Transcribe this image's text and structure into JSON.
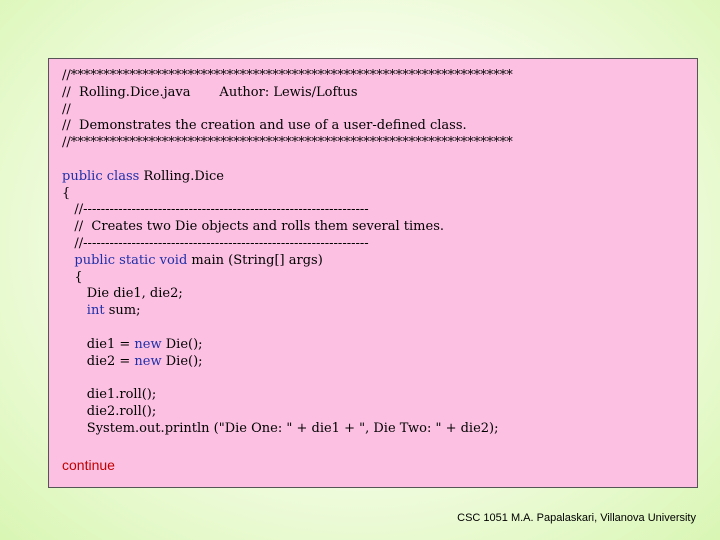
{
  "code_lines": [
    "//********************************************************************",
    "//  Rolling.Dice.java       Author: Lewis/Loftus",
    "//",
    "//  Demonstrates the creation and use of a user-defined class.",
    "//********************************************************************",
    "",
    "public class Rolling.Dice",
    "{",
    "   //-----------------------------------------------------------------",
    "   //  Creates two Die objects and rolls them several times.",
    "   //-----------------------------------------------------------------",
    "   public static void main (String[] args)",
    "   {",
    "      Die die1, die2;",
    "      int sum;",
    "",
    "      die1 = new Die();",
    "      die2 = new Die();",
    "",
    "      die1.roll();",
    "      die2.roll();",
    "      System.out.println (\"Die One: \" + die1 + \", Die Two: \" + die2);"
  ],
  "keywords": [
    "public",
    "class",
    "static",
    "void",
    "int",
    "new"
  ],
  "continue_link": "continue",
  "footer": "CSC 1051 M.A. Papalaskari, Villanova University"
}
